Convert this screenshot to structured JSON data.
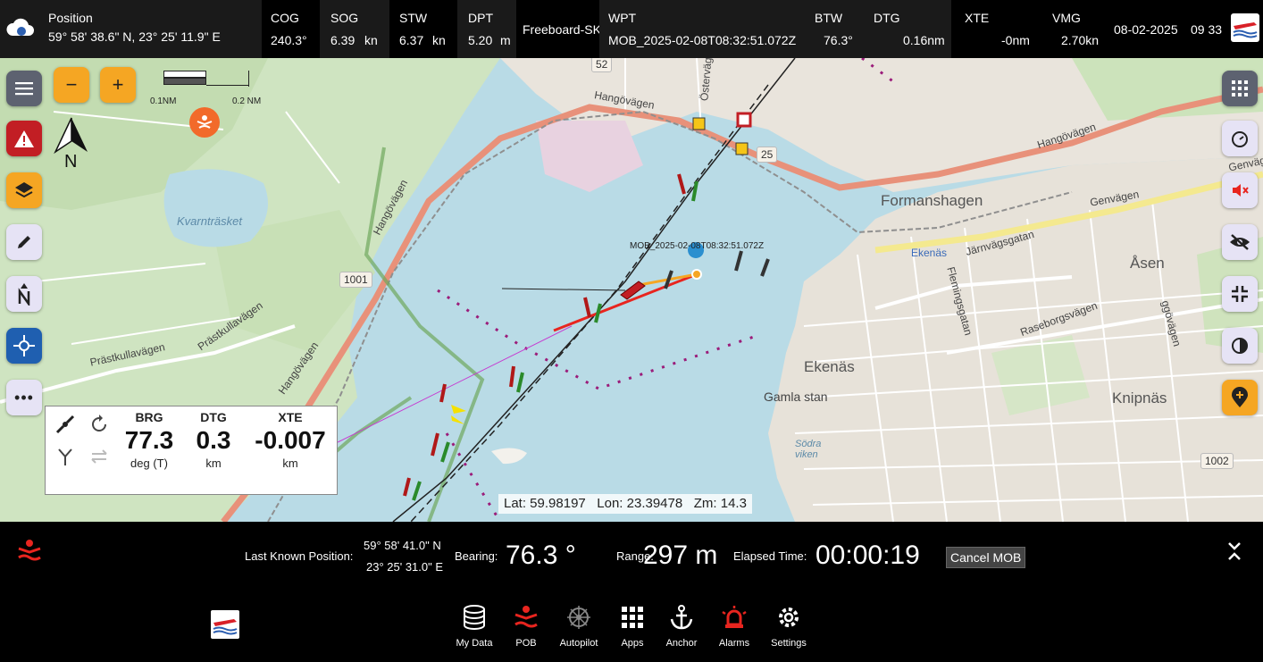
{
  "topbar": {
    "position": {
      "label": "Position",
      "value": "59° 58' 38.6\" N, 23° 25' 11.9\" E"
    },
    "cog": {
      "label": "COG",
      "value": "240.3°"
    },
    "sog": {
      "label": "SOG",
      "value": "6.39",
      "unit": "kn"
    },
    "stw": {
      "label": "STW",
      "value": "6.37",
      "unit": "kn"
    },
    "dpt": {
      "label": "DPT",
      "value": "5.20",
      "unit": "m"
    },
    "vessel": "Freeboard-SK",
    "wpt": {
      "label": "WPT",
      "value": "MOB_2025-02-08T08:32:51.072Z"
    },
    "btw": {
      "label": "BTW",
      "value": "76.3°"
    },
    "dtg": {
      "label": "DTG",
      "value": "0.16nm"
    },
    "xte": {
      "label": "XTE",
      "value": "-0nm"
    },
    "vmg": {
      "label": "VMG",
      "value": "2.70kn"
    },
    "date": "08-02-2025",
    "time": "09 33"
  },
  "map": {
    "scale_left": "0.1NM",
    "scale_right": "0.2 NM",
    "north_label": "N",
    "mob_label": "MOB_2025-02-08T08:32:51.072Z",
    "places": {
      "formanshagen": "Formanshagen",
      "ekenas": "Ekenäs",
      "ekenas_station": "Ekenäs",
      "asen": "Åsen",
      "gamla_stan": "Gamla stan",
      "knipnas": "Knipnäs",
      "kvarntrasket": "Kvarnträsket",
      "sodra_viken": "Södra viken"
    },
    "roads": {
      "hangovagen_1": "Hangövägen",
      "hangovagen_2": "Hangövägen",
      "hangovagen_3": "Hangövägen",
      "hangovagen_4": "Hangövägen",
      "genvagen_1": "Genvägen",
      "genvagen_2": "Genvägen",
      "jarnvagsgatan": "Järnvägsgatan",
      "flemingsgatan": "Flemingsgatan",
      "raseborgsvagen": "Raseborgsvägen",
      "prastkullavagen_1": "Prästkullavägen",
      "prastkullavagen_2": "Prästkullavägen",
      "ostervagen": "Östervägen",
      "ggovagen": "ggövägen"
    },
    "road_numbers": {
      "r52": "52",
      "r25": "25",
      "r1001": "1001",
      "r1002": "1002"
    },
    "coords": {
      "lat": "Lat: 59.98197",
      "lon": "Lon: 23.39478",
      "zoom": "Zm: 14.3"
    }
  },
  "course_widget": {
    "brg": {
      "label": "BRG",
      "value": "77.3",
      "unit": "deg (T)"
    },
    "dtg": {
      "label": "DTG",
      "value": "0.3",
      "unit": "km"
    },
    "xte": {
      "label": "XTE",
      "value": "-0.007",
      "unit": "km"
    }
  },
  "mob": {
    "last_known_label": "Last Known Position:",
    "lat": "59° 58' 41.0\" N",
    "lon": "23° 25' 31.0\" E",
    "bearing_label": "Bearing:",
    "bearing_value": "76.3 °",
    "range_label": "Range:",
    "range_value": "297 m",
    "elapsed_label": "Elapsed Time:",
    "elapsed_value": "00:00:19",
    "cancel": "Cancel MOB"
  },
  "nav": [
    {
      "label": "My Data"
    },
    {
      "label": "POB"
    },
    {
      "label": "Autopilot"
    },
    {
      "label": "Apps"
    },
    {
      "label": "Anchor"
    },
    {
      "label": "Alarms"
    },
    {
      "label": "Settings"
    }
  ],
  "colors": {
    "alarm_red": "#e8251f",
    "accent_yellow": "#f5a623",
    "topbar_bg": "#000000"
  }
}
